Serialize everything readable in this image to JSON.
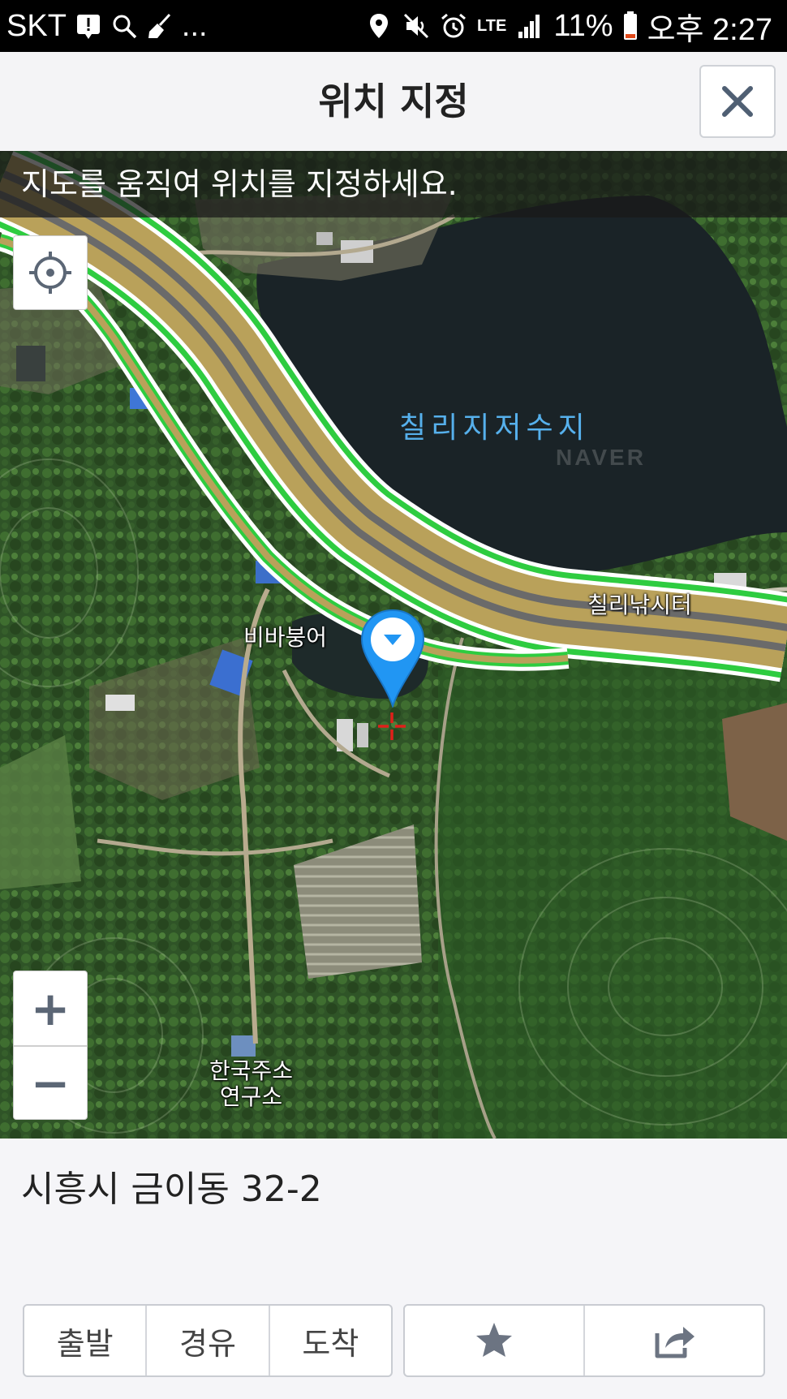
{
  "status_bar": {
    "carrier": "SKT",
    "more": "...",
    "network": "LTE",
    "battery": "11%",
    "time": "오후 2:27",
    "icons": [
      "alert-icon",
      "search-icon",
      "broom-icon",
      "location-icon",
      "mute-icon",
      "alarm-icon",
      "lte-icon",
      "signal-icon",
      "battery-icon"
    ]
  },
  "header": {
    "title": "위치 지정",
    "close_icon": "close-icon"
  },
  "map": {
    "instruction": "지도를 움직여 위치를 지정하세요.",
    "labels": {
      "lake": "칠리지저수지",
      "fishing": "칠리낚시터",
      "place1": "비바붕어",
      "place2_line1": "한국주소",
      "place2_line2": "연구소"
    },
    "watermark": "NAVER",
    "controls": {
      "locate_icon": "crosshair-locate-icon",
      "zoom_in": "+",
      "zoom_out": "−"
    }
  },
  "panel": {
    "address": "시흥시 금이동 32-2",
    "route_buttons": [
      "출발",
      "경유",
      "도착"
    ],
    "action_icons": [
      "star-icon",
      "share-icon"
    ]
  },
  "colors": {
    "accent_pin": "#2196f3",
    "road_green": "#2ecc40",
    "road_tan": "#b9a15a",
    "lake": "#1a2327"
  }
}
